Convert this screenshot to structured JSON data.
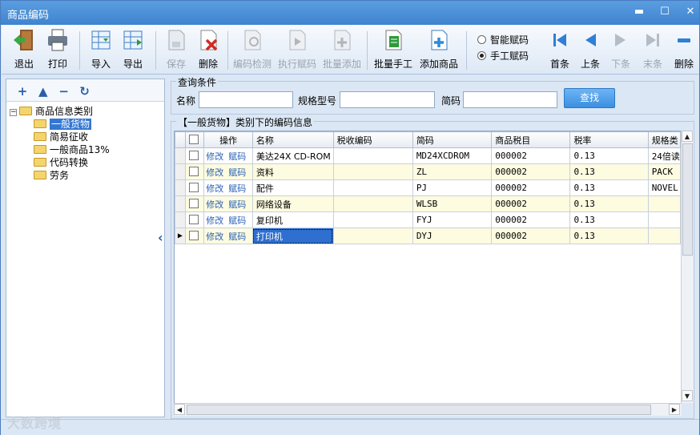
{
  "window": {
    "title": "商品编码",
    "min": "▬",
    "max": "☐",
    "close": "✕"
  },
  "toolbar": [
    {
      "key": "exit",
      "label": "退出",
      "enabled": true,
      "icon": "door-exit-icon"
    },
    {
      "key": "print",
      "label": "打印",
      "enabled": true,
      "icon": "printer-icon"
    },
    {
      "key": "import",
      "label": "导入",
      "enabled": true,
      "icon": "table-import-icon"
    },
    {
      "key": "export",
      "label": "导出",
      "enabled": true,
      "icon": "table-export-icon"
    },
    {
      "key": "save",
      "label": "保存",
      "enabled": false,
      "icon": "save-icon"
    },
    {
      "key": "delete",
      "label": "删除",
      "enabled": true,
      "icon": "delete-doc-icon"
    },
    {
      "key": "check",
      "label": "编码检测",
      "enabled": false,
      "icon": "check-code-icon"
    },
    {
      "key": "assign",
      "label": "执行赋码",
      "enabled": false,
      "icon": "assign-code-icon"
    },
    {
      "key": "batchadd",
      "label": "批量添加",
      "enabled": false,
      "icon": "batch-add-icon"
    },
    {
      "key": "batchmanual",
      "label": "批量手工",
      "enabled": true,
      "icon": "batch-manual-icon"
    },
    {
      "key": "addproduct",
      "label": "添加商品",
      "enabled": true,
      "icon": "add-product-icon"
    }
  ],
  "radio": {
    "smart": "智能赋码",
    "manual": "手工赋码",
    "selected": "manual"
  },
  "nav": {
    "first": "首条",
    "prev": "上条",
    "next": "下条",
    "last": "末条",
    "delete": "删除"
  },
  "tree": {
    "root": "商品信息类别",
    "children": [
      "一般货物",
      "简易征收",
      "一般商品13%",
      "代码转换",
      "劳务"
    ],
    "selected": "一般货物"
  },
  "query": {
    "legend": "查询条件",
    "name_label": "名称",
    "model_label": "规格型号",
    "code_label": "简码",
    "search_label": "查找"
  },
  "grid": {
    "legend": "【一般货物】类别下的编码信息",
    "columns": [
      "",
      "操作",
      "名称",
      "税收编码",
      "简码",
      "商品税目",
      "税率",
      "规格类"
    ],
    "edit_label": "修改",
    "assign_label": "赋码",
    "rows": [
      {
        "name": "美达24X CD-ROM",
        "taxcode": "",
        "short": "MD24XCDROM",
        "item": "000002",
        "rate": "0.13",
        "spec": "24倍读"
      },
      {
        "name": "资料",
        "taxcode": "",
        "short": "ZL",
        "item": "000002",
        "rate": "0.13",
        "spec": "PACK"
      },
      {
        "name": "配件",
        "taxcode": "",
        "short": "PJ",
        "item": "000002",
        "rate": "0.13",
        "spec": "NOVEL"
      },
      {
        "name": "网络设备",
        "taxcode": "",
        "short": "WLSB",
        "item": "000002",
        "rate": "0.13",
        "spec": ""
      },
      {
        "name": "复印机",
        "taxcode": "",
        "short": "FYJ",
        "item": "000002",
        "rate": "0.13",
        "spec": ""
      },
      {
        "name": "打印机",
        "taxcode": "",
        "short": "DYJ",
        "item": "000002",
        "rate": "0.13",
        "spec": ""
      }
    ],
    "current_row": 5
  },
  "watermark": "大数跨境",
  "colors": {
    "titlebar": "#3f84cf",
    "selection": "#2e6fd0",
    "link": "#2a62b6"
  }
}
